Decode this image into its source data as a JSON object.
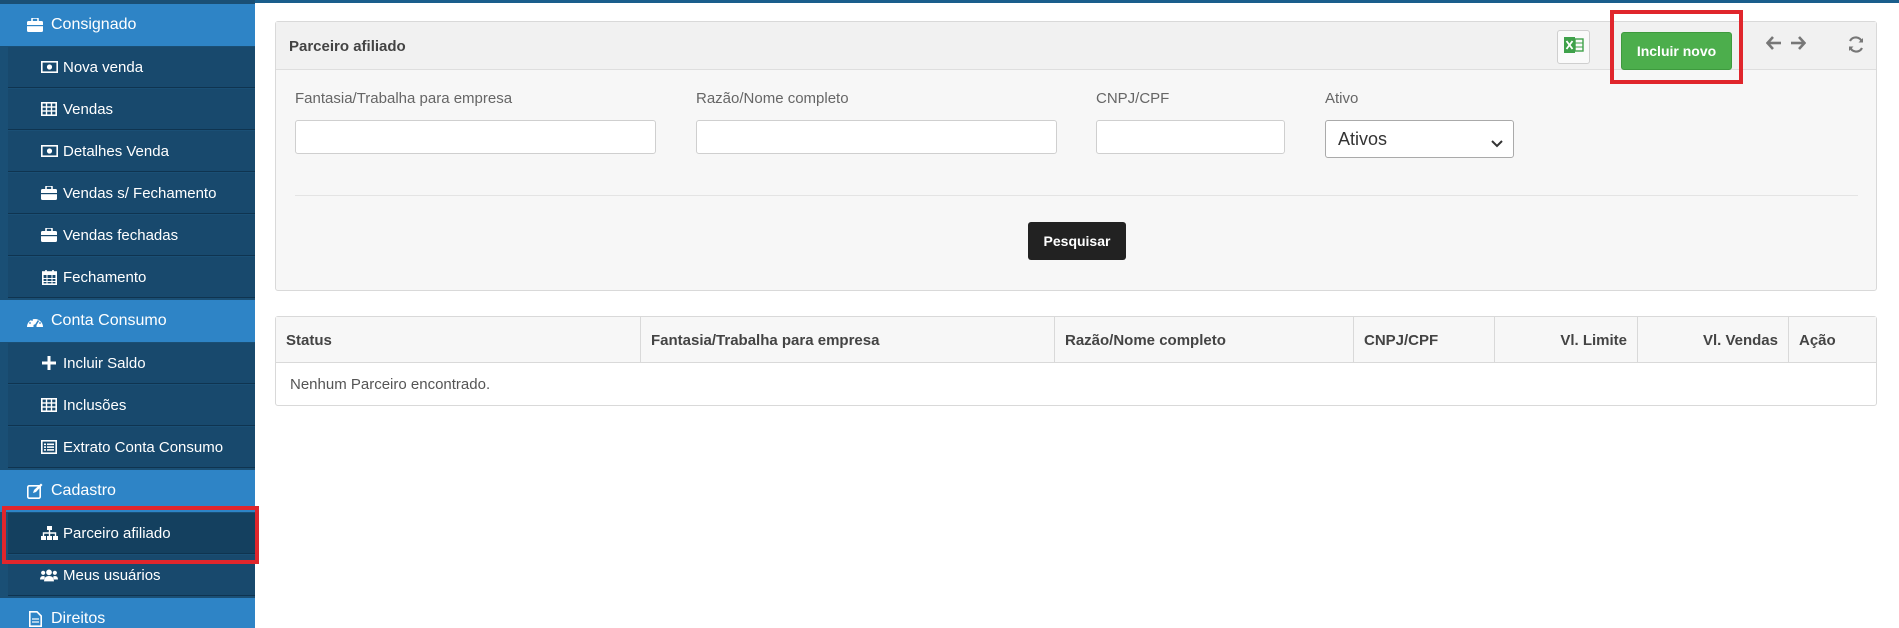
{
  "sidebar": {
    "sections": [
      {
        "label": "Consignado",
        "icon": "briefcase-icon"
      },
      {
        "label": "Conta Consumo",
        "icon": "dashboard-icon"
      },
      {
        "label": "Cadastro",
        "icon": "edit-icon"
      },
      {
        "label": "Direitos",
        "icon": "file-icon"
      }
    ],
    "items": [
      {
        "label": "Nova venda",
        "icon": "money-icon"
      },
      {
        "label": "Vendas",
        "icon": "table-icon"
      },
      {
        "label": "Detalhes Venda",
        "icon": "money-icon"
      },
      {
        "label": "Vendas s/ Fechamento",
        "icon": "briefcase-icon"
      },
      {
        "label": "Vendas fechadas",
        "icon": "briefcase-icon"
      },
      {
        "label": "Fechamento",
        "icon": "calendar-icon"
      },
      {
        "label": "Incluir Saldo",
        "icon": "plus-icon"
      },
      {
        "label": "Inclusões",
        "icon": "table-icon"
      },
      {
        "label": "Extrato Conta Consumo",
        "icon": "list-icon"
      },
      {
        "label": "Parceiro afiliado",
        "icon": "sitemap-icon"
      },
      {
        "label": "Meus usuários",
        "icon": "users-icon"
      }
    ]
  },
  "panel": {
    "title": "Parceiro afiliado",
    "new_button": "Incluir novo",
    "search_button": "Pesquisar",
    "fields": {
      "fantasia_label": "Fantasia/Trabalha para empresa",
      "fantasia_value": "",
      "razao_label": "Razão/Nome completo",
      "razao_value": "",
      "cnpj_label": "CNPJ/CPF",
      "cnpj_value": "",
      "ativo_label": "Ativo",
      "ativo_value": "Ativos"
    }
  },
  "table": {
    "columns": [
      "Status",
      "Fantasia/Trabalha para empresa",
      "Razão/Nome completo",
      "CNPJ/CPF",
      "Vl. Limite",
      "Vl. Vendas",
      "Ação"
    ],
    "empty_message": "Nenhum Parceiro encontrado."
  },
  "colors": {
    "sidebar_section": "#2e84c6",
    "sidebar_item": "#18496d",
    "new_button": "#4cae4c",
    "highlight": "#e0262c"
  }
}
